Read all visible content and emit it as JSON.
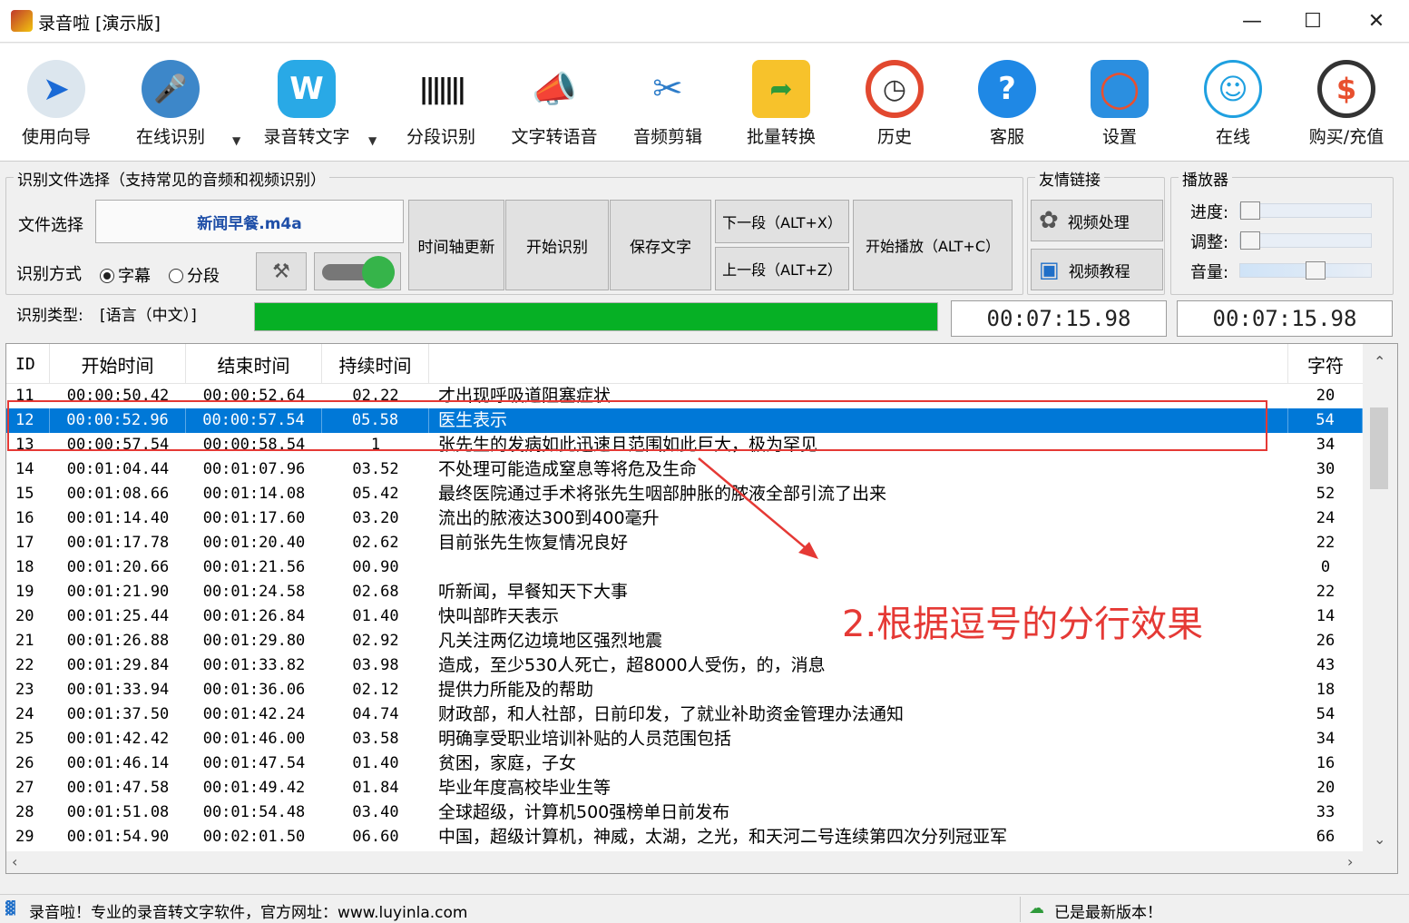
{
  "window": {
    "title": "录音啦 [演示版]"
  },
  "toolbar": [
    {
      "label": "使用向导",
      "icon": "navigation-arrow-icon"
    },
    {
      "label": "在线识别",
      "icon": "microphone-icon"
    },
    {
      "label": "录音转文字",
      "icon": "w-logo-icon"
    },
    {
      "label": "分段识别",
      "icon": "waveform-icon"
    },
    {
      "label": "文字转语音",
      "icon": "megaphone-icon"
    },
    {
      "label": "音频剪辑",
      "icon": "scissors-icon"
    },
    {
      "label": "批量转换",
      "icon": "folder-convert-icon"
    },
    {
      "label": "历史",
      "icon": "clock-history-icon"
    },
    {
      "label": "客服",
      "icon": "help-icon"
    },
    {
      "label": "设置",
      "icon": "lifebuoy-icon"
    },
    {
      "label": "在线",
      "icon": "user-icon"
    },
    {
      "label": "购买/充值",
      "icon": "dollar-coin-icon"
    }
  ],
  "file_group": {
    "title": "识别文件选择（支持常见的音频和视频识别）",
    "file_label": "文件选择",
    "file_name": "新闻早餐.m4a",
    "mode_label": "识别方式",
    "mode_subtitle": "字幕",
    "mode_segment": "分段",
    "type_label": "识别类型:",
    "type_value": "[语言（中文）]"
  },
  "buttons": {
    "timeline_update": "时间轴更新",
    "start_recognize": "开始识别",
    "save_text": "保存文字",
    "next_segment": "下一段（ALT+X）",
    "prev_segment": "上一段（ALT+Z）",
    "start_play": "开始播放（ALT+C）"
  },
  "progress": {
    "value": 1.0,
    "color": "#06b025"
  },
  "links_group": {
    "title": "友情链接",
    "video_process": "视频处理",
    "video_tutorial": "视频教程"
  },
  "player_group": {
    "title": "播放器",
    "progress_label": "进度:",
    "adjust_label": "调整:",
    "volume_label": "音量:",
    "progress_value": 0.0,
    "adjust_value": 0.0,
    "volume_value": 0.58
  },
  "time_display_1": "00:07:15.98",
  "time_display_2": "00:07:15.98",
  "table": {
    "headers": [
      "ID",
      "开始时间",
      "结束时间",
      "持续时间",
      "",
      "字符"
    ],
    "rows": [
      {
        "id": "11",
        "start": "00:00:50.42",
        "end": "00:00:52.64",
        "dur": "02.22",
        "text": "才出现呼吸道阻塞症状",
        "chars": "20"
      },
      {
        "id": "12",
        "start": "00:00:52.96",
        "end": "00:00:57.54",
        "dur": "05.58",
        "text": "医生表示",
        "chars": "54",
        "selected": true
      },
      {
        "id": "13",
        "start": "00:00:57.54",
        "end": "00:00:58.54",
        "dur": "1",
        "text": "张先生的发病如此迅速且范围如此巨大，极为罕见",
        "chars": "34"
      },
      {
        "id": "14",
        "start": "00:01:04.44",
        "end": "00:01:07.96",
        "dur": "03.52",
        "text": "不处理可能造成窒息等将危及生命",
        "chars": "30"
      },
      {
        "id": "15",
        "start": "00:01:08.66",
        "end": "00:01:14.08",
        "dur": "05.42",
        "text": "最终医院通过手术将张先生咽部肿胀的脓液全部引流了出来",
        "chars": "52"
      },
      {
        "id": "16",
        "start": "00:01:14.40",
        "end": "00:01:17.60",
        "dur": "03.20",
        "text": "流出的脓液达300到400毫升",
        "chars": "24"
      },
      {
        "id": "17",
        "start": "00:01:17.78",
        "end": "00:01:20.40",
        "dur": "02.62",
        "text": "目前张先生恢复情况良好",
        "chars": "22"
      },
      {
        "id": "18",
        "start": "00:01:20.66",
        "end": "00:01:21.56",
        "dur": "00.90",
        "text": "",
        "chars": "0"
      },
      {
        "id": "19",
        "start": "00:01:21.90",
        "end": "00:01:24.58",
        "dur": "02.68",
        "text": "听新闻，早餐知天下大事",
        "chars": "22"
      },
      {
        "id": "20",
        "start": "00:01:25.44",
        "end": "00:01:26.84",
        "dur": "01.40",
        "text": "快叫部昨天表示",
        "chars": "14"
      },
      {
        "id": "21",
        "start": "00:01:26.88",
        "end": "00:01:29.80",
        "dur": "02.92",
        "text": "凡关注两亿边境地区强烈地震",
        "chars": "26"
      },
      {
        "id": "22",
        "start": "00:01:29.84",
        "end": "00:01:33.82",
        "dur": "03.98",
        "text": "造成，至少530人死亡，超8000人受伤，的，消息",
        "chars": "43"
      },
      {
        "id": "23",
        "start": "00:01:33.94",
        "end": "00:01:36.06",
        "dur": "02.12",
        "text": "提供力所能及的帮助",
        "chars": "18"
      },
      {
        "id": "24",
        "start": "00:01:37.50",
        "end": "00:01:42.24",
        "dur": "04.74",
        "text": "财政部，和人社部，日前印发，了就业补助资金管理办法通知",
        "chars": "54"
      },
      {
        "id": "25",
        "start": "00:01:42.42",
        "end": "00:01:46.00",
        "dur": "03.58",
        "text": "明确享受职业培训补贴的人员范围包括",
        "chars": "34"
      },
      {
        "id": "26",
        "start": "00:01:46.14",
        "end": "00:01:47.54",
        "dur": "01.40",
        "text": "贫困，家庭，子女",
        "chars": "16"
      },
      {
        "id": "27",
        "start": "00:01:47.58",
        "end": "00:01:49.42",
        "dur": "01.84",
        "text": "毕业年度高校毕业生等",
        "chars": "20"
      },
      {
        "id": "28",
        "start": "00:01:51.08",
        "end": "00:01:54.48",
        "dur": "03.40",
        "text": "全球超级，计算机500强榜单日前发布",
        "chars": "33"
      },
      {
        "id": "29",
        "start": "00:01:54.90",
        "end": "00:02:01.50",
        "dur": "06.60",
        "text": "中国，超级计算机，神威，太湖，之光，和天河二号连续第四次分列冠亚军",
        "chars": "66"
      }
    ]
  },
  "annotation": "2.根据逗号的分行效果",
  "status": {
    "left": "录音啦！专业的录音转文字软件，官方网址：www.luyinla.com",
    "right": "已是最新版本！"
  },
  "colors": {
    "selection": "#0078d7",
    "annotation": "#e53935",
    "progress": "#06b025"
  }
}
